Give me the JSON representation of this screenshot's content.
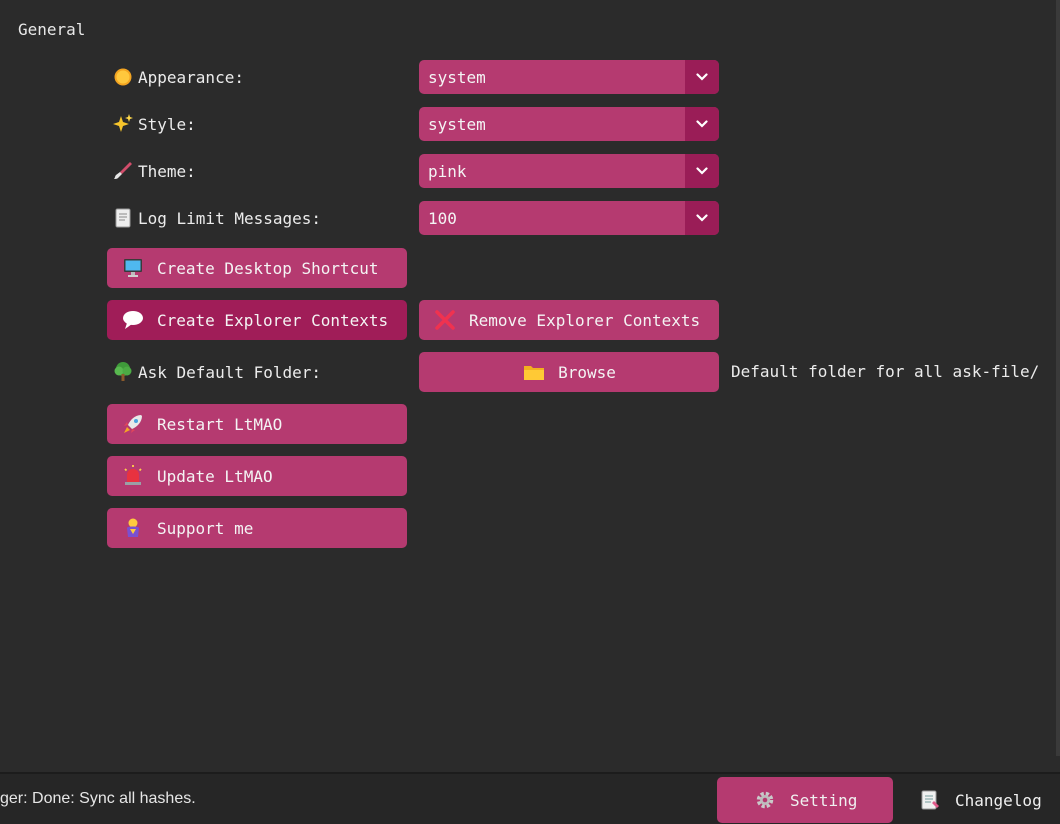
{
  "section": {
    "title": "General"
  },
  "settings": {
    "appearance": {
      "label": "Appearance:",
      "value": "system",
      "icon": "sun-icon"
    },
    "style": {
      "label": "Style:",
      "value": "system",
      "icon": "sparkles-icon"
    },
    "theme": {
      "label": "Theme:",
      "value": "pink",
      "icon": "paintbrush-icon"
    },
    "log_limit": {
      "label": "Log Limit Messages:",
      "value": "100",
      "icon": "page-icon"
    },
    "ask_folder": {
      "label": "Ask Default Folder:",
      "icon": "tree-icon",
      "browse_label": "Browse",
      "hint": "Default folder for all ask-file/"
    }
  },
  "buttons": {
    "desktop_shortcut": "Create Desktop Shortcut",
    "create_contexts": "Create Explorer Contexts",
    "remove_contexts": "Remove Explorer Contexts",
    "restart": "Restart LtMAO",
    "update": "Update LtMAO",
    "support": "Support me"
  },
  "statusbar": {
    "message": "ger: Done: Sync all hashes.",
    "tabs": {
      "setting": "Setting",
      "changelog": "Changelog"
    }
  },
  "colors": {
    "accent": "#b53a70",
    "accent_dark": "#a01d58",
    "background": "#2b2b2b"
  }
}
